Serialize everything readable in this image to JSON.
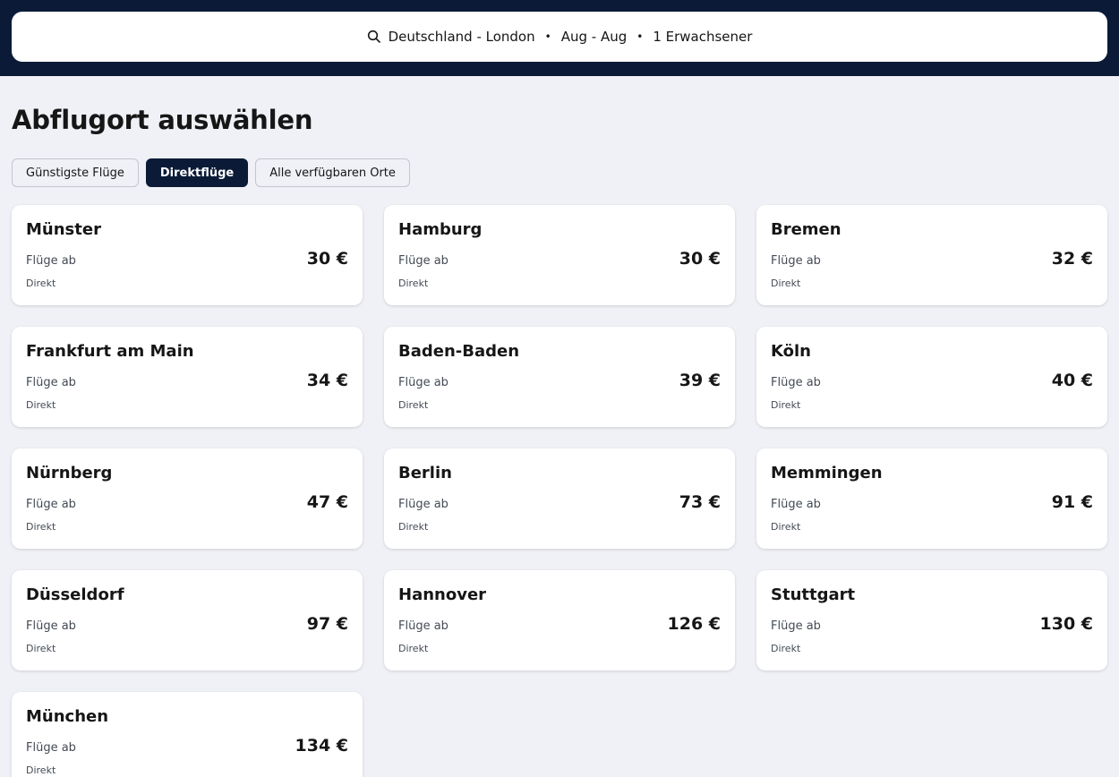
{
  "search": {
    "route": "Deutschland - London",
    "dates": "Aug - Aug",
    "travelers": "1 Erwachsener",
    "separator": "•"
  },
  "page_title": "Abflugort auswählen",
  "filters": [
    {
      "label": "Günstigste Flüge",
      "active": false
    },
    {
      "label": "Direktflüge",
      "active": true
    },
    {
      "label": "Alle verfügbaren Orte",
      "active": false
    }
  ],
  "card_label": "Flüge ab",
  "cards": [
    {
      "city": "Münster",
      "price": "30 €",
      "stops": "Direkt"
    },
    {
      "city": "Hamburg",
      "price": "30 €",
      "stops": "Direkt"
    },
    {
      "city": "Bremen",
      "price": "32 €",
      "stops": "Direkt"
    },
    {
      "city": "Frankfurt am Main",
      "price": "34 €",
      "stops": "Direkt"
    },
    {
      "city": "Baden-Baden",
      "price": "39 €",
      "stops": "Direkt"
    },
    {
      "city": "Köln",
      "price": "40 €",
      "stops": "Direkt"
    },
    {
      "city": "Nürnberg",
      "price": "47 €",
      "stops": "Direkt"
    },
    {
      "city": "Berlin",
      "price": "73 €",
      "stops": "Direkt"
    },
    {
      "city": "Memmingen",
      "price": "91 €",
      "stops": "Direkt"
    },
    {
      "city": "Düsseldorf",
      "price": "97 €",
      "stops": "Direkt"
    },
    {
      "city": "Hannover",
      "price": "126 €",
      "stops": "Direkt"
    },
    {
      "city": "Stuttgart",
      "price": "130 €",
      "stops": "Direkt"
    },
    {
      "city": "München",
      "price": "134 €",
      "stops": "Direkt"
    }
  ],
  "colors": {
    "header_bg": "#0b1b37",
    "page_bg": "#eff1f6",
    "active_chip": "#0b1b37"
  }
}
